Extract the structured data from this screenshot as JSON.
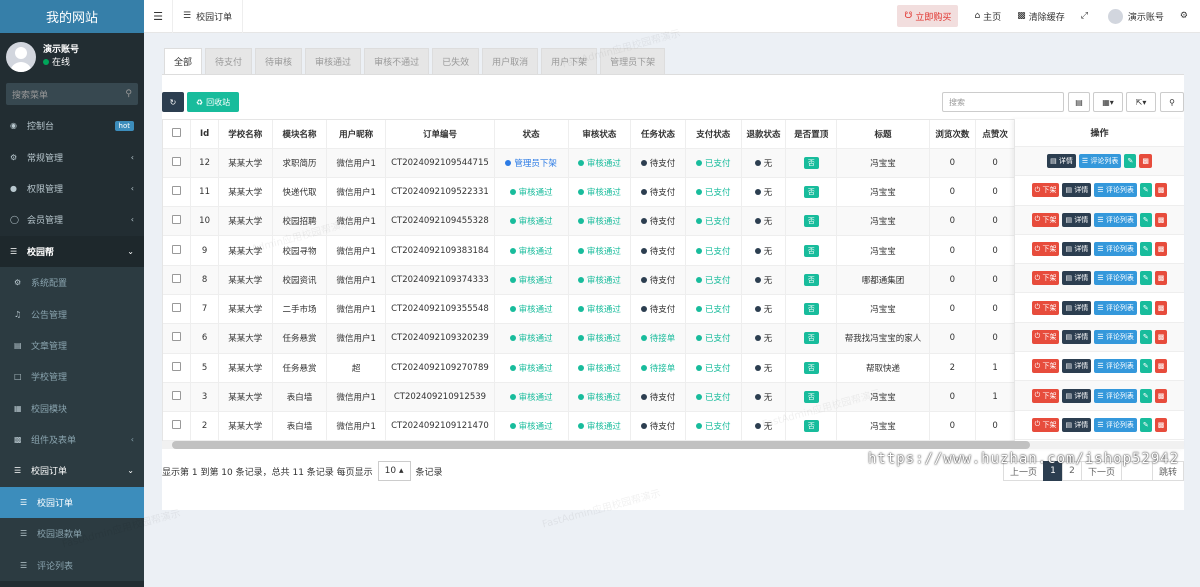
{
  "app": {
    "title": "我的网站"
  },
  "user": {
    "name": "演示账号",
    "status": "在线"
  },
  "sidebar_search": {
    "placeholder": "搜索菜单"
  },
  "sidebar": {
    "items": [
      {
        "label": "控制台",
        "badge": "hot"
      },
      {
        "label": "常规管理"
      },
      {
        "label": "权限管理"
      },
      {
        "label": "会员管理"
      },
      {
        "label": "校园帮"
      },
      {
        "label": "系统配置"
      },
      {
        "label": "公告管理"
      },
      {
        "label": "文章管理"
      },
      {
        "label": "学校管理"
      },
      {
        "label": "校园模块"
      },
      {
        "label": "组件及表单"
      },
      {
        "label": "校园订单"
      },
      {
        "label": "校园订单"
      },
      {
        "label": "校园退款单"
      },
      {
        "label": "评论列表"
      }
    ]
  },
  "topbar": {
    "tab_label": "校园订单",
    "buy_label": "立即购买",
    "home_label": "主页",
    "clear_cache_label": "清除缓存",
    "account_label": "演示账号"
  },
  "filter_tabs": [
    "全部",
    "待支付",
    "待审核",
    "审核通过",
    "审核不通过",
    "已失效",
    "用户取消",
    "用户下架",
    "管理员下架"
  ],
  "toolbar": {
    "recycle_label": "回收站",
    "search_placeholder": "搜索"
  },
  "table": {
    "columns": [
      "Id",
      "学校名称",
      "模块名称",
      "用户昵称",
      "订单编号",
      "状态",
      "审核状态",
      "任务状态",
      "支付状态",
      "退款状态",
      "是否置顶",
      "标题",
      "浏览次数",
      "点赞次"
    ],
    "rows": [
      {
        "id": "12",
        "school": "某某大学",
        "module": "求职简历",
        "nick": "微信用户1",
        "order": "CT2024092109544715",
        "status": "管理员下架",
        "status_color": "blue",
        "audit": "审核通过",
        "task": "待支付",
        "task_color": "dark",
        "pay": "已支付",
        "refund": "无",
        "top": "否",
        "title": "冯宝宝",
        "views": "0",
        "likes": "0"
      },
      {
        "id": "11",
        "school": "某某大学",
        "module": "快递代取",
        "nick": "微信用户1",
        "order": "CT2024092109522331",
        "status": "审核通过",
        "status_color": "green",
        "audit": "审核通过",
        "task": "待支付",
        "task_color": "dark",
        "pay": "已支付",
        "refund": "无",
        "top": "否",
        "title": "冯宝宝",
        "views": "0",
        "likes": "0"
      },
      {
        "id": "10",
        "school": "某某大学",
        "module": "校园招聘",
        "nick": "微信用户1",
        "order": "CT2024092109455328",
        "status": "审核通过",
        "status_color": "green",
        "audit": "审核通过",
        "task": "待支付",
        "task_color": "dark",
        "pay": "已支付",
        "refund": "无",
        "top": "否",
        "title": "冯宝宝",
        "views": "0",
        "likes": "0"
      },
      {
        "id": "9",
        "school": "某某大学",
        "module": "校园寻物",
        "nick": "微信用户1",
        "order": "CT2024092109383184",
        "status": "审核通过",
        "status_color": "green",
        "audit": "审核通过",
        "task": "待支付",
        "task_color": "dark",
        "pay": "已支付",
        "refund": "无",
        "top": "否",
        "title": "冯宝宝",
        "views": "0",
        "likes": "0"
      },
      {
        "id": "8",
        "school": "某某大学",
        "module": "校园资讯",
        "nick": "微信用户1",
        "order": "CT2024092109374333",
        "status": "审核通过",
        "status_color": "green",
        "audit": "审核通过",
        "task": "待支付",
        "task_color": "dark",
        "pay": "已支付",
        "refund": "无",
        "top": "否",
        "title": "哪都通集团",
        "views": "0",
        "likes": "0"
      },
      {
        "id": "7",
        "school": "某某大学",
        "module": "二手市场",
        "nick": "微信用户1",
        "order": "CT2024092109355548",
        "status": "审核通过",
        "status_color": "green",
        "audit": "审核通过",
        "task": "待支付",
        "task_color": "dark",
        "pay": "已支付",
        "refund": "无",
        "top": "否",
        "title": "冯宝宝",
        "views": "0",
        "likes": "0"
      },
      {
        "id": "6",
        "school": "某某大学",
        "module": "任务悬赏",
        "nick": "微信用户1",
        "order": "CT2024092109320239",
        "status": "审核通过",
        "status_color": "green",
        "audit": "审核通过",
        "task": "待接单",
        "task_color": "green",
        "pay": "已支付",
        "refund": "无",
        "top": "否",
        "title": "帮我找冯宝宝的家人",
        "views": "0",
        "likes": "0"
      },
      {
        "id": "5",
        "school": "某某大学",
        "module": "任务悬赏",
        "nick": "超",
        "order": "CT2024092109270789",
        "status": "审核通过",
        "status_color": "green",
        "audit": "审核通过",
        "task": "待接单",
        "task_color": "green",
        "pay": "已支付",
        "refund": "无",
        "top": "否",
        "title": "帮取快递",
        "views": "2",
        "likes": "1"
      },
      {
        "id": "3",
        "school": "某某大学",
        "module": "表白墙",
        "nick": "微信用户1",
        "order": "CT202409210912539",
        "status": "审核通过",
        "status_color": "green",
        "audit": "审核通过",
        "task": "待支付",
        "task_color": "dark",
        "pay": "已支付",
        "refund": "无",
        "top": "否",
        "title": "冯宝宝",
        "views": "0",
        "likes": "1"
      },
      {
        "id": "2",
        "school": "某某大学",
        "module": "表白墙",
        "nick": "微信用户1",
        "order": "CT2024092109121470",
        "status": "审核通过",
        "status_color": "green",
        "audit": "审核通过",
        "task": "待支付",
        "task_color": "dark",
        "pay": "已支付",
        "refund": "无",
        "top": "否",
        "title": "冯宝宝",
        "views": "0",
        "likes": "0"
      }
    ]
  },
  "ops": {
    "header": "操作",
    "offline_label": "下架",
    "detail_label": "详情",
    "comments_label": "评论列表"
  },
  "footer": {
    "summary": "显示第 1 到第 10 条记录，总共 11 条记录 每页显示",
    "page_size": "10",
    "suffix": "条记录",
    "prev": "上一页",
    "pages": [
      "1",
      "2"
    ],
    "next": "下一页",
    "jump": "跳转"
  },
  "watermark_text": "FastAdmin应用校园帮演示",
  "url_overlay": "https://www.huzhan.com/ishop52942",
  "colors": {
    "sidebar": "#222d32",
    "active": "#3c8dbc",
    "green": "#18bc9c",
    "red": "#e74c3c",
    "dark": "#2c3e50"
  }
}
